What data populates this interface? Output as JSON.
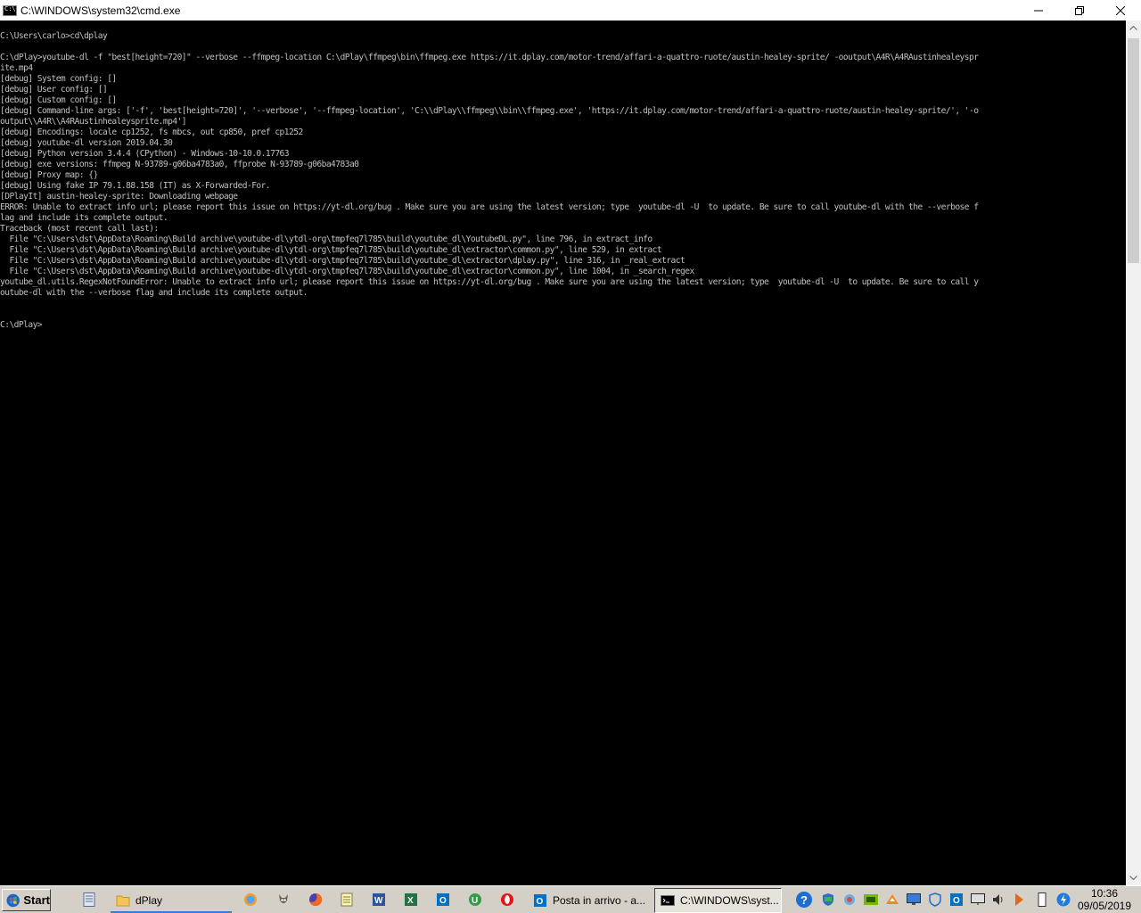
{
  "window": {
    "title": "C:\\WINDOWS\\system32\\cmd.exe",
    "icon": "cmd-icon",
    "icon_text": "C:\\",
    "buttons": [
      "minimize-icon",
      "restore-icon",
      "close-icon"
    ]
  },
  "console": {
    "lines": [
      "C:\\Users\\carlo>cd\\dplay",
      "",
      "C:\\dPlay>youtube-dl -f \"best[height=720]\" --verbose --ffmpeg-location C:\\dPlay\\ffmpeg\\bin\\ffmpeg.exe https://it.dplay.com/motor-trend/affari-a-quattro-ruote/austin-healey-sprite/ -ooutput\\A4R\\A4RAustinhealeyspr",
      "ite.mp4",
      "[debug] System config: []",
      "[debug] User config: []",
      "[debug] Custom config: []",
      "[debug] Command-line args: ['-f', 'best[height=720]', '--verbose', '--ffmpeg-location', 'C:\\\\dPlay\\\\ffmpeg\\\\bin\\\\ffmpeg.exe', 'https://it.dplay.com/motor-trend/affari-a-quattro-ruote/austin-healey-sprite/', '-o",
      "output\\\\A4R\\\\A4RAustinhealeysprite.mp4']",
      "[debug] Encodings: locale cp1252, fs mbcs, out cp850, pref cp1252",
      "[debug] youtube-dl version 2019.04.30",
      "[debug] Python version 3.4.4 (CPython) - Windows-10-10.0.17763",
      "[debug] exe versions: ffmpeg N-93789-g06ba4783a0, ffprobe N-93789-g06ba4783a0",
      "[debug] Proxy map: {}",
      "[debug] Using fake IP 79.1.88.158 (IT) as X-Forwarded-For.",
      "[DPlayIt] austin-healey-sprite: Downloading webpage",
      "ERROR: Unable to extract info url; please report this issue on https://yt-dl.org/bug . Make sure you are using the latest version; type  youtube-dl -U  to update. Be sure to call youtube-dl with the --verbose f",
      "lag and include its complete output.",
      "Traceback (most recent call last):",
      "  File \"C:\\Users\\dst\\AppData\\Roaming\\Build archive\\youtube-dl\\ytdl-org\\tmpfeq7l785\\build\\youtube_dl\\YoutubeDL.py\", line 796, in extract_info",
      "  File \"C:\\Users\\dst\\AppData\\Roaming\\Build archive\\youtube-dl\\ytdl-org\\tmpfeq7l785\\build\\youtube_dl\\extractor\\common.py\", line 529, in extract",
      "  File \"C:\\Users\\dst\\AppData\\Roaming\\Build archive\\youtube-dl\\ytdl-org\\tmpfeq7l785\\build\\youtube_dl\\extractor\\dplay.py\", line 316, in _real_extract",
      "  File \"C:\\Users\\dst\\AppData\\Roaming\\Build archive\\youtube-dl\\ytdl-org\\tmpfeq7l785\\build\\youtube_dl\\extractor\\common.py\", line 1004, in _search_regex",
      "youtube_dl.utils.RegexNotFoundError: Unable to extract info url; please report this issue on https://yt-dl.org/bug . Make sure you are using the latest version; type  youtube-dl -U  to update. Be sure to call y",
      "outube-dl with the --verbose flag and include its complete output.",
      "",
      "",
      "C:\\dPlay>"
    ]
  },
  "taskbar": {
    "start_label": "Start",
    "quick_launch": [
      "desktop-icon",
      "browser-icon",
      "gimp-icon",
      "firefox-icon",
      "notepad-icon",
      "word-icon",
      "excel-icon",
      "outlook-icon",
      "utorrent-icon",
      "opera-icon"
    ],
    "folder_task": "dPlay",
    "tasks": [
      {
        "label": "Posta in arrivo - a...",
        "icon": "outlook-icon"
      },
      {
        "label": "C:\\WINDOWS\\syst...",
        "icon": "cmd-icon"
      }
    ],
    "tray_icons": [
      "help-icon",
      "shield-icon",
      "network-icon",
      "nvidia-icon",
      "mail-icon",
      "defender-icon",
      "outlook-icon",
      "monitor-icon",
      "volume-icon",
      "flag-icon",
      "usb-icon",
      "update-icon"
    ],
    "clock": {
      "time": "10:36",
      "date": "09/05/2019"
    }
  },
  "colors": {
    "console_bg": "#000000",
    "console_fg": "#c0c0c0",
    "taskbar_bg": "#d4d0c8",
    "active_underline": "#3a7bd5"
  }
}
